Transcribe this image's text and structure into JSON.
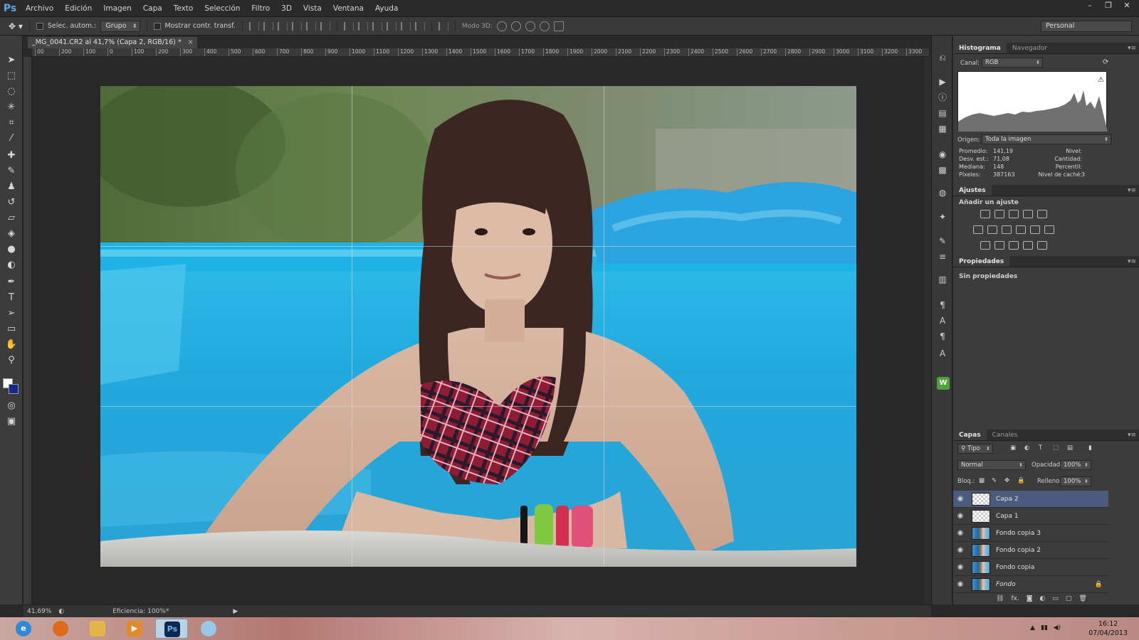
{
  "app": {
    "logo": "Ps"
  },
  "menu": [
    "Archivo",
    "Edición",
    "Imagen",
    "Capa",
    "Texto",
    "Selección",
    "Filtro",
    "3D",
    "Vista",
    "Ventana",
    "Ayuda"
  ],
  "window_buttons": [
    "–",
    "❐",
    "✕"
  ],
  "options": {
    "tool_icon": "move-tool-icon",
    "auto_select_label": "Selec. autom.:",
    "auto_select_value": "Grupo",
    "show_transform_label": "Mostrar contr. transf.",
    "mode3d_label": "Modo 3D:",
    "workspace": "Personal"
  },
  "document": {
    "tab_title": "_MG_0041.CR2 al 41,7% (Capa 2, RGB/16) *",
    "close": "×"
  },
  "ruler": {
    "h_ticks": [
      "00",
      "200",
      "100",
      "0",
      "100",
      "200",
      "300",
      "400",
      "500",
      "600",
      "700",
      "800",
      "900",
      "1000",
      "1100",
      "1200",
      "1300",
      "1400",
      "1500",
      "1600",
      "1700",
      "1800",
      "1900",
      "2000",
      "2100",
      "2200",
      "2300",
      "2400",
      "2500",
      "2600",
      "2700",
      "2800",
      "2900",
      "3000",
      "3100",
      "3200",
      "3300"
    ]
  },
  "status": {
    "zoom": "41,69%",
    "efficiency": "Eficiencia: 100%*"
  },
  "histogram_panel": {
    "tabs": [
      "Histograma",
      "Navegador"
    ],
    "canal_label": "Canal:",
    "canal_value": "RGB",
    "origen_label": "Origen:",
    "origen_value": "Toda la imagen",
    "stats_left": [
      {
        "label": "Promedio:",
        "value": "141,19"
      },
      {
        "label": "Desv. est.:",
        "value": "71,08"
      },
      {
        "label": "Mediana:",
        "value": "148"
      },
      {
        "label": "Píxeles:",
        "value": "387163"
      }
    ],
    "stats_right": [
      {
        "label": "Nivel:",
        "value": ""
      },
      {
        "label": "Cantidad:",
        "value": ""
      },
      {
        "label": "Percentil:",
        "value": ""
      },
      {
        "label": "Nivel de caché:",
        "value": "3"
      }
    ]
  },
  "adjustments_panel": {
    "tab": "Ajustes",
    "heading": "Añadir un ajuste"
  },
  "properties_panel": {
    "tab": "Propiedades",
    "empty": "Sin propiedades"
  },
  "layers_panel": {
    "tabs": [
      "Capas",
      "Canales"
    ],
    "filter_value": "Tipo",
    "blend_mode": "Normal",
    "opacity_label": "Opacidad:",
    "opacity_value": "100%",
    "lock_label": "Bloq.:",
    "fill_label": "Relleno:",
    "fill_value": "100%",
    "bottom_icons": [
      "⛓",
      "fx.",
      "◙",
      "◐",
      "▭",
      "▢",
      "🗑"
    ],
    "layers": [
      {
        "name": "Capa 2",
        "thumb": "checker",
        "selected": true
      },
      {
        "name": "Capa 1",
        "thumb": "checker",
        "selected": false
      },
      {
        "name": "Fondo copia 3",
        "thumb": "photo",
        "selected": false
      },
      {
        "name": "Fondo copia 2",
        "thumb": "photo",
        "selected": false
      },
      {
        "name": "Fondo copia",
        "thumb": "photo",
        "selected": false
      },
      {
        "name": "Fondo",
        "thumb": "photo",
        "selected": false,
        "italic": true,
        "locked": true
      }
    ]
  },
  "taskbar": {
    "ps_label": "Ps",
    "time": "16:12",
    "date": "07/04/2013"
  }
}
